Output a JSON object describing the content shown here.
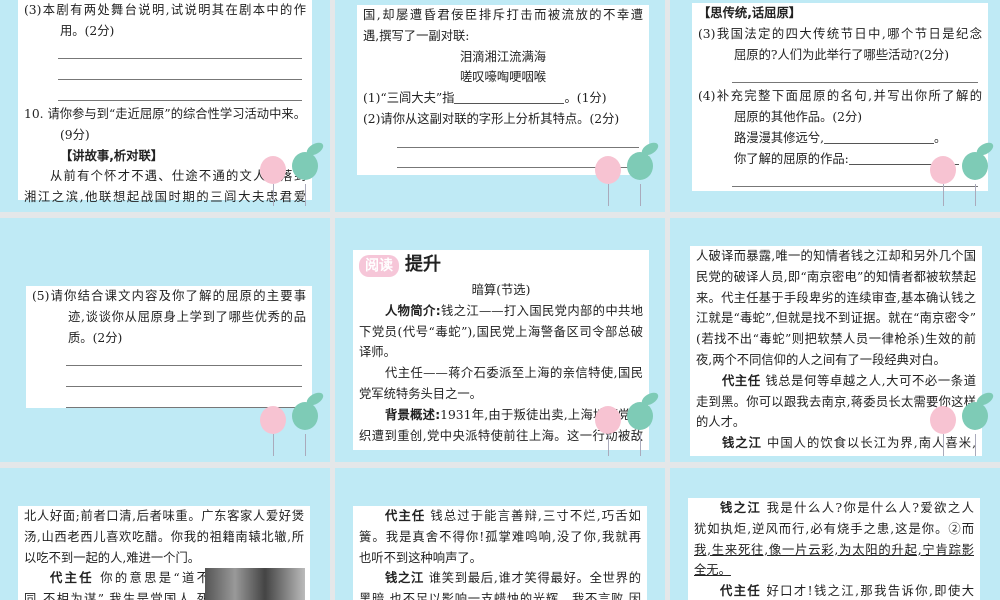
{
  "panels": [
    {
      "lines": [
        {
          "text": "(3)本剧有两处舞台说明,试说明其在剧本中的作",
          "style": "full"
        },
        {
          "text": "用。(2分)",
          "style": "indent"
        },
        {
          "text": "",
          "style": "rule"
        },
        {
          "text": "",
          "style": "rule"
        },
        {
          "text": "",
          "style": "rule"
        },
        {
          "text": "10. 请你参与到“走近屈原”的综合性学习活动中来。",
          "style": "full"
        },
        {
          "text": "(9分)",
          "style": "indent"
        },
        {
          "text": "【讲故事,析对联】",
          "style": "indent lead"
        },
        {
          "text": "从前有个怀才不遇、仕途不通的文人流落到",
          "style": "full para"
        },
        {
          "text": "湘江之滨,他联想起战国时期的三闾大夫忠君爱",
          "style": "full"
        }
      ]
    },
    {
      "lines": [
        {
          "text": "国,却屡遭昏君佞臣排斥打击而被流放的不幸遭",
          "style": "full"
        },
        {
          "text": "遇,撰写了一副对联:",
          "style": ""
        },
        {
          "text": "泪滴湘江流满海",
          "style": "center"
        },
        {
          "text": "嗟叹嚎啕哽咽喉",
          "style": "center"
        },
        {
          "text": "(1)“三闾大夫”指",
          "blank": true,
          "after": "。(1分)",
          "style": ""
        },
        {
          "text": "(2)请你从这副对联的字形上分析其特点。(2分)",
          "style": ""
        },
        {
          "text": "",
          "style": "rule"
        },
        {
          "text": "",
          "style": "rule"
        }
      ]
    },
    {
      "lines": [
        {
          "text": "【思传统,话屈原】",
          "style": "lead"
        },
        {
          "text": "(3)我国法定的四大传统节日中,哪个节日是纪念",
          "style": "full"
        },
        {
          "text": "屈原的?人们为此举行了哪些活动?(2分)",
          "style": "indent"
        },
        {
          "text": "",
          "style": "rule"
        },
        {
          "text": "(4)补充完整下面屈原的名句,并写出你所了解的",
          "style": "full"
        },
        {
          "text": "屈原的其他作品。(2分)",
          "style": "indent"
        },
        {
          "text": "路漫漫其修远兮,",
          "blank": true,
          "after": "。",
          "style": "indent"
        },
        {
          "text": "你了解的屈原的作品:",
          "blank": true,
          "after": "",
          "style": "indent"
        },
        {
          "text": "",
          "style": "rule"
        }
      ]
    },
    {
      "lines": [
        {
          "text": "(5)请你结合课文内容及你了解的屈原的主要事",
          "style": "full"
        },
        {
          "text": "迹,谈谈你从屈原身上学到了哪些优秀的品",
          "style": "full indent"
        },
        {
          "text": "质。(2分)",
          "style": "indent"
        },
        {
          "text": "",
          "style": "rule"
        },
        {
          "text": "",
          "style": "rule"
        },
        {
          "text": "",
          "style": "rule"
        }
      ]
    },
    {
      "header": {
        "badge": "阅读",
        "title": "提升"
      },
      "lines": [
        {
          "text": "暗算(节选)",
          "style": "center"
        },
        {
          "lead": "人物简介:",
          "text": "钱之江——打入国民党内部的中共地",
          "style": "full para"
        },
        {
          "text": "下党员(代号“毒蛇”),国民党上海警备区司令部总破",
          "style": "full"
        },
        {
          "text": "译师。",
          "style": ""
        },
        {
          "text": "代主任——蒋介石委派至上海的亲信特使,国民",
          "style": "full para"
        },
        {
          "text": "党军统特务头目之一。",
          "style": ""
        },
        {
          "lead": "背景概述:",
          "text": "1931年,由于叛徒出卖,上海地下党组",
          "style": "full para"
        },
        {
          "text": "织遭到重创,党中央派特使前往上海。这一行动被敌",
          "style": "full"
        }
      ]
    },
    {
      "lines": [
        {
          "text": "人破译而暴露,唯一的知情者钱之江却和另外几个国",
          "style": "full"
        },
        {
          "text": "民党的破译人员,即“南京密电”的知情者都被软禁起",
          "style": "full"
        },
        {
          "text": "来。代主任基于手段卑劣的连续审查,基本确认钱之",
          "style": "full"
        },
        {
          "text": "江就是“毒蛇”,但就是找不到证据。就在“南京密令”",
          "style": "full"
        },
        {
          "text": "(若找不出“毒蛇”则把软禁人员一律枪杀)生效的前",
          "style": "full"
        },
        {
          "text": "夜,两个不同信仰的人之间有了一段经典对白。",
          "style": ""
        },
        {
          "lead": "代主任",
          "text": "  钱总是何等卓越之人,大可不必一条道",
          "style": "full para"
        },
        {
          "text": "走到黑。你可以跟我去南京,蒋委员长太需要你这样",
          "style": "full"
        },
        {
          "text": "的人才。",
          "style": ""
        },
        {
          "lead": "钱之江",
          "text": "  中国人的饮食以长江为界,南人喜米,",
          "style": "full para"
        }
      ]
    },
    {
      "lines": [
        {
          "text": "北人好面;前者口清,后者味重。广东客家人爱好煲",
          "style": "full"
        },
        {
          "text": "汤,山西老西儿喜欢吃醋。你我的祖籍南辕北辙,所",
          "style": "full"
        },
        {
          "text": "以吃不到一起的人,难进一个门。",
          "style": ""
        },
        {
          "lead": "代主任",
          "text": "  你的意思是“道不",
          "style": "full para narrow"
        },
        {
          "text": "同,不相为谋”,我生是党国人,死",
          "style": "full narrow"
        }
      ]
    },
    {
      "lines": [
        {
          "lead": "代主任",
          "text": "  钱总过于能言善辩,三寸不烂,巧舌如",
          "style": "full para"
        },
        {
          "text": "簧。我是真舍不得你!孤掌难鸣响,没了你,我就再",
          "style": "full"
        },
        {
          "text": "也听不到这种响声了。",
          "style": ""
        },
        {
          "lead": "钱之江",
          "text": "  谁笑到最后,谁才笑得最好。全世界的",
          "style": "full para"
        },
        {
          "text": "黑暗,也不足以影响一支蜡烛的光辉。我不言败,因",
          "style": "full"
        }
      ]
    },
    {
      "lines": [
        {
          "lead": "钱之江",
          "text": "  我是什么人?你是什么人?爱欲之人",
          "style": "full para"
        },
        {
          "text": "犹如执炬,逆风而行,必有烧手之患,这是你。②而",
          "style": "full"
        },
        {
          "text": "我,生来死往,像一片云彩,为太阳的升起,宁肯踪影",
          "style": "full ul"
        },
        {
          "text": "全无。",
          "style": "ul"
        },
        {
          "lead": "代主任",
          "text": "  好口才!钱之江,那我告诉你,即使大",
          "style": "full para"
        }
      ]
    }
  ]
}
